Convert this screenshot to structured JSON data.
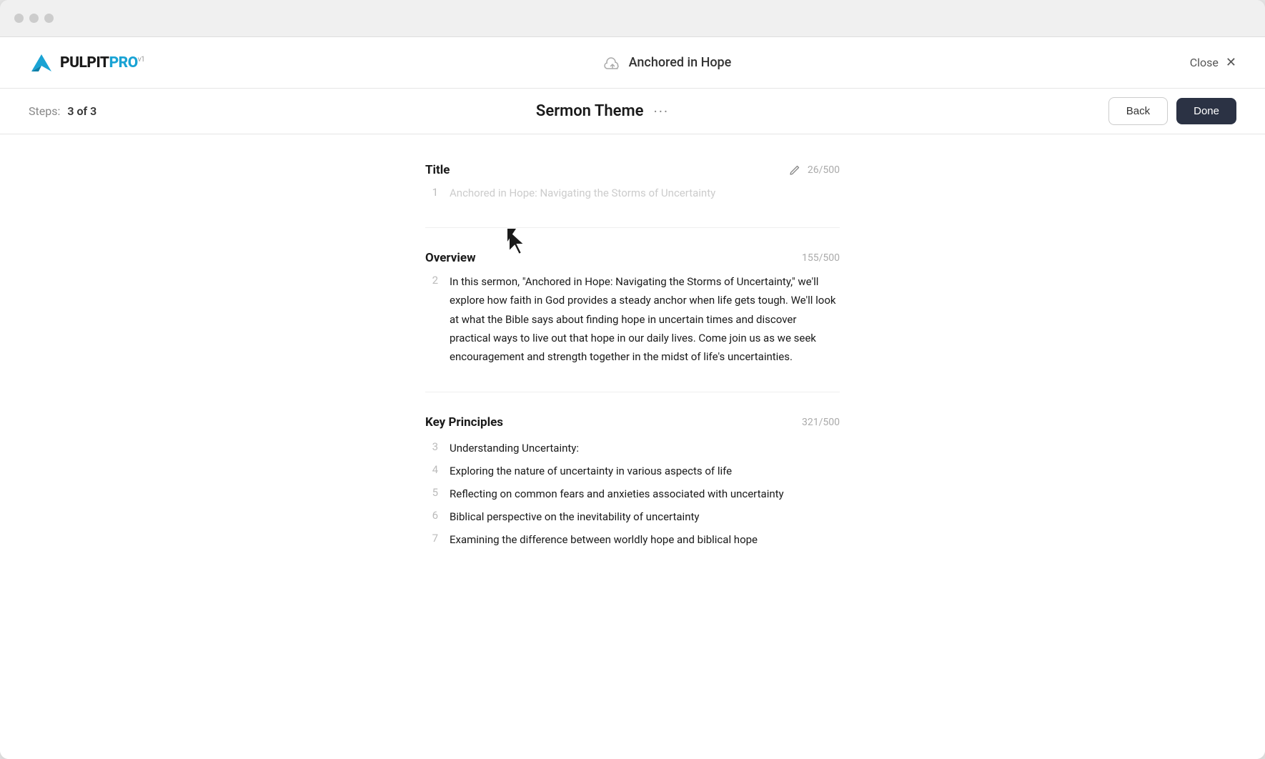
{
  "window": {
    "title_bar": {
      "dots": [
        "dot1",
        "dot2",
        "dot3"
      ]
    },
    "header": {
      "logo_text": "PULPITPRO",
      "logo_version": "v1",
      "cloud_label": "Anchored in Hope",
      "close_label": "Close"
    },
    "step_bar": {
      "steps_label": "Steps:",
      "steps_count": "3 of 3",
      "step_title": "Sermon Theme",
      "dots_menu": "···",
      "back_label": "Back",
      "done_label": "Done"
    },
    "content": {
      "title_section": {
        "label": "Title",
        "char_count": "26/500",
        "row_number": "1",
        "placeholder": "Anchored in Hope: Navigating the Storms of Uncertainty"
      },
      "overview_section": {
        "label": "Overview",
        "char_count": "155/500",
        "row_number": "2",
        "text": "In this sermon, \"Anchored in Hope: Navigating the Storms of Uncertainty,\" we'll explore how faith in God provides a steady anchor when life gets tough. We'll look at what the Bible says about finding hope in uncertain times and discover practical ways to live out that hope in our daily lives. Come join us as we seek encouragement and strength together in the midst of life's uncertainties."
      },
      "key_principles_section": {
        "label": "Key Principles",
        "char_count": "321/500",
        "principles": [
          {
            "num": "3",
            "text": "Understanding Uncertainty:"
          },
          {
            "num": "4",
            "text": "Exploring the nature of uncertainty in various aspects of life"
          },
          {
            "num": "5",
            "text": "Reflecting on common fears and anxieties associated with uncertainty"
          },
          {
            "num": "6",
            "text": "Biblical perspective on the inevitability of uncertainty"
          },
          {
            "num": "7",
            "text": "Examining the difference between worldly hope and biblical hope"
          }
        ]
      }
    }
  }
}
